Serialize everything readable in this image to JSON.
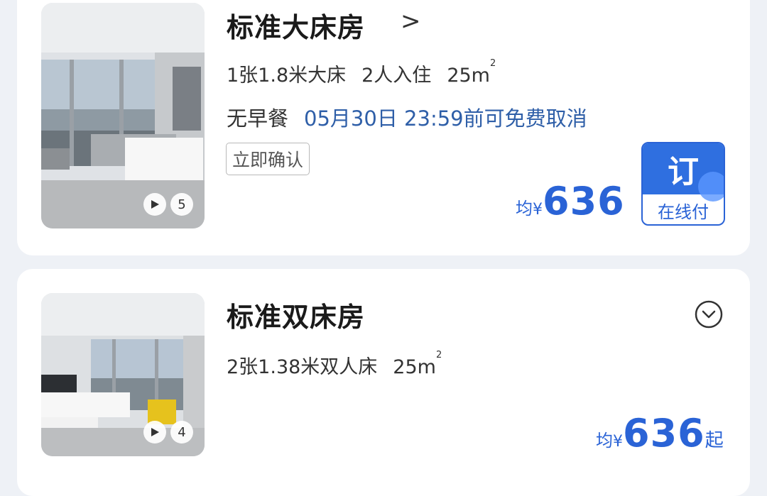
{
  "rooms": [
    {
      "title": "标准大床房",
      "title_arrow": ">",
      "bed": "1张1.8米大床",
      "guests": "2人入住",
      "area": "25m",
      "area_sup": "2",
      "meal": "无早餐",
      "cancel_policy": "05月30日 23:59前可免费取消",
      "tag": "立即确认",
      "media_count": "5",
      "price_prefix": "均",
      "currency": "¥",
      "price": "636",
      "book_label": "订",
      "book_sub": "在线付"
    },
    {
      "title": "标准双床房",
      "bed": "2张1.38米双人床",
      "area": "25m",
      "area_sup": "2",
      "media_count": "4",
      "price_prefix": "均",
      "currency": "¥",
      "price": "636",
      "price_suffix": "起"
    }
  ],
  "colors": {
    "accent": "#2a63d6",
    "cancel_text": "#2f5fa8",
    "background": "#eef1f6"
  },
  "icons": {
    "title_arrow": "chevron-right-icon",
    "expand": "chevron-down-circle-icon",
    "media": "play-icon"
  }
}
